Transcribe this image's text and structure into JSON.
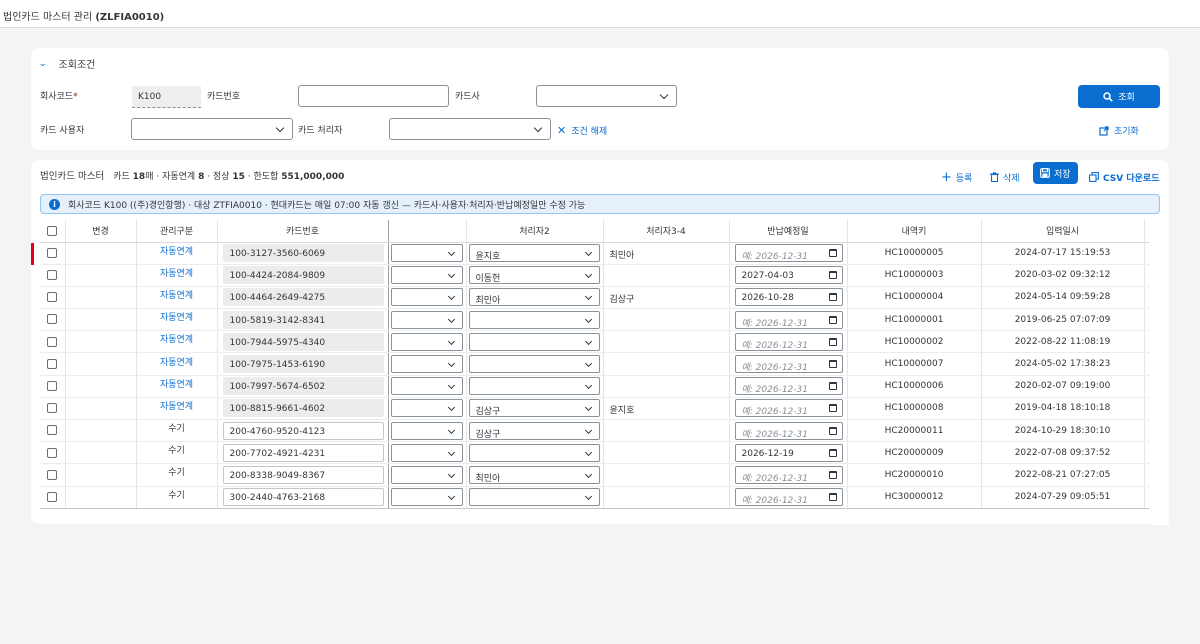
{
  "app": {
    "title": "법인카드 마스터 관리",
    "code": "(ZLFIA0010)"
  },
  "filter": {
    "header": "조회조건",
    "company_label": "회사코드",
    "company_value": "K100",
    "card_no_label": "카드번호",
    "card_no_value": "",
    "card_co_label": "카드사",
    "user_label": "카드 사용자",
    "handler_label": "카드 처리자",
    "clear_label": "조건 해제",
    "search_label": "조회",
    "reset_label": "초기화"
  },
  "master": {
    "title": "법인카드 마스터",
    "summary_cards_label": "카드",
    "summary_cards": "18",
    "summary_cards_unit": "매 · 자동연계",
    "summary_auto": "8",
    "summary_normal_label": " · 정상",
    "summary_normal": "15",
    "summary_limit_label": " · 한도합",
    "summary_limit": "551,000,000",
    "btn_add": "등록",
    "btn_delete": "삭제",
    "btn_save": "저장",
    "btn_csv": "CSV 다운로드",
    "info": "회사코드 K100 ((주)경인항행) · 대상 ZTFIA0010 · 현대카드는 매일 07:00 자동 갱신 — 카드사·사용자·처리자·반납예정일만 수정 가능"
  },
  "columns": [
    "변경",
    "관리구분",
    "카드번호",
    "",
    "처리자2",
    "처리자3-4",
    "반납예정일",
    "내역키",
    "입력일시"
  ],
  "date_placeholder": "예: 2026-12-31",
  "rows": [
    {
      "type": "자동연계",
      "card": "100-3127-3560-6069",
      "h2": "윤지호",
      "h34": "최민아",
      "date": "",
      "key": "HC10000005",
      "ts": "2024-07-17 15:19:53"
    },
    {
      "type": "자동연계",
      "card": "100-4424-2084-9809",
      "h2": "이동헌",
      "h34": "",
      "date": "2027-04-03",
      "key": "HC10000003",
      "ts": "2020-03-02 09:32:12"
    },
    {
      "type": "자동연계",
      "card": "100-4464-2649-4275",
      "h2": "최민아",
      "h34": "김상구",
      "date": "2026-10-28",
      "key": "HC10000004",
      "ts": "2024-05-14 09:59:28"
    },
    {
      "type": "자동연계",
      "card": "100-5819-3142-8341",
      "h2": "",
      "h34": "",
      "date": "",
      "key": "HC10000001",
      "ts": "2019-06-25 07:07:09"
    },
    {
      "type": "자동연계",
      "card": "100-7944-5975-4340",
      "h2": "",
      "h34": "",
      "date": "",
      "key": "HC10000002",
      "ts": "2022-08-22 11:08:19"
    },
    {
      "type": "자동연계",
      "card": "100-7975-1453-6190",
      "h2": "",
      "h34": "",
      "date": "",
      "key": "HC10000007",
      "ts": "2024-05-02 17:38:23"
    },
    {
      "type": "자동연계",
      "card": "100-7997-5674-6502",
      "h2": "",
      "h34": "",
      "date": "",
      "key": "HC10000006",
      "ts": "2020-02-07 09:19:00"
    },
    {
      "type": "자동연계",
      "card": "100-8815-9661-4602",
      "h2": "김상구",
      "h34": "윤지호",
      "date": "",
      "key": "HC10000008",
      "ts": "2019-04-18 18:10:18"
    },
    {
      "type": "수기",
      "card": "200-4760-9520-4123",
      "h2": "김상구",
      "h34": "",
      "date": "",
      "key": "HC20000011",
      "ts": "2024-10-29 18:30:10"
    },
    {
      "type": "수기",
      "card": "200-7702-4921-4231",
      "h2": "",
      "h34": "",
      "date": "2026-12-19",
      "key": "HC20000009",
      "ts": "2022-07-08 09:37:52"
    },
    {
      "type": "수기",
      "card": "200-8338-9049-8367",
      "h2": "최민아",
      "h34": "",
      "date": "",
      "key": "HC20000010",
      "ts": "2022-08-21 07:27:05"
    },
    {
      "type": "수기",
      "card": "300-2440-4763-2168",
      "h2": "",
      "h34": "",
      "date": "",
      "key": "HC30000012",
      "ts": "2024-07-29 09:05:51"
    }
  ]
}
